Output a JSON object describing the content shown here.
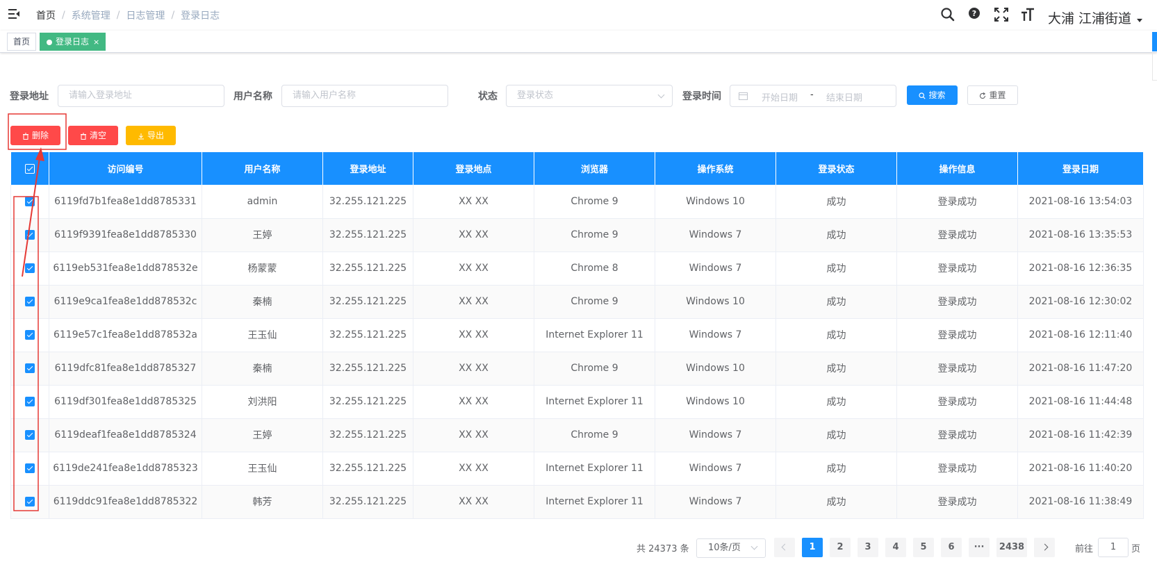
{
  "header": {
    "breadcrumb": [
      "首页",
      "系统管理",
      "日志管理",
      "登录日志"
    ],
    "user_name": "大浦  江浦街道",
    "icons": [
      "search-icon",
      "help-icon",
      "fullscreen-icon",
      "font-size-icon"
    ]
  },
  "tags": [
    {
      "label": "首页",
      "active": false
    },
    {
      "label": "登录日志",
      "active": true,
      "close": "×"
    }
  ],
  "search": {
    "ipaddr_label": "登录地址",
    "ipaddr_placeholder": "请输入登录地址",
    "username_label": "用户名称",
    "username_placeholder": "请输入用户名称",
    "status_label": "状态",
    "status_placeholder": "登录状态",
    "time_label": "登录时间",
    "start_placeholder": "开始日期",
    "range_separator": "-",
    "end_placeholder": "结束日期",
    "search_btn": "搜索",
    "reset_btn": "重置"
  },
  "toolbar": {
    "delete_btn": "删除",
    "clean_btn": "清空",
    "export_btn": "导出"
  },
  "table": {
    "columns": [
      "访问编号",
      "用户名称",
      "登录地址",
      "登录地点",
      "浏览器",
      "操作系统",
      "登录状态",
      "操作信息",
      "登录日期"
    ],
    "rows": [
      [
        "6119fd7b1fea8e1dd8785331",
        "admin",
        "32.255.121.225",
        "XX XX",
        "Chrome 9",
        "Windows 10",
        "成功",
        "登录成功",
        "2021-08-16 13:54:03"
      ],
      [
        "6119f9391fea8e1dd8785330",
        "王婷",
        "32.255.121.225",
        "XX XX",
        "Chrome 9",
        "Windows 7",
        "成功",
        "登录成功",
        "2021-08-16 13:35:53"
      ],
      [
        "6119eb531fea8e1dd878532e",
        "杨蒙蒙",
        "32.255.121.225",
        "XX XX",
        "Chrome 8",
        "Windows 7",
        "成功",
        "登录成功",
        "2021-08-16 12:36:35"
      ],
      [
        "6119e9ca1fea8e1dd878532c",
        "秦楠",
        "32.255.121.225",
        "XX XX",
        "Chrome 9",
        "Windows 10",
        "成功",
        "登录成功",
        "2021-08-16 12:30:02"
      ],
      [
        "6119e57c1fea8e1dd878532a",
        "王玉仙",
        "32.255.121.225",
        "XX XX",
        "Internet Explorer 11",
        "Windows 7",
        "成功",
        "登录成功",
        "2021-08-16 12:11:40"
      ],
      [
        "6119dfc81fea8e1dd8785327",
        "秦楠",
        "32.255.121.225",
        "XX XX",
        "Chrome 9",
        "Windows 10",
        "成功",
        "登录成功",
        "2021-08-16 11:47:20"
      ],
      [
        "6119df301fea8e1dd8785325",
        "刘洪阳",
        "32.255.121.225",
        "XX XX",
        "Internet Explorer 11",
        "Windows 10",
        "成功",
        "登录成功",
        "2021-08-16 11:44:48"
      ],
      [
        "6119deaf1fea8e1dd8785324",
        "王婷",
        "32.255.121.225",
        "XX XX",
        "Chrome 9",
        "Windows 7",
        "成功",
        "登录成功",
        "2021-08-16 11:42:39"
      ],
      [
        "6119de241fea8e1dd8785323",
        "王玉仙",
        "32.255.121.225",
        "XX XX",
        "Internet Explorer 11",
        "Windows 7",
        "成功",
        "登录成功",
        "2021-08-16 11:40:20"
      ],
      [
        "6119ddc91fea8e1dd8785322",
        "韩芳",
        "32.255.121.225",
        "XX XX",
        "Internet Explorer 11",
        "Windows 7",
        "成功",
        "登录成功",
        "2021-08-16 11:38:49"
      ]
    ]
  },
  "pagination": {
    "total": "共 24373 条",
    "page_size": "10条/页",
    "pages": [
      "1",
      "2",
      "3",
      "4",
      "5",
      "6",
      "···",
      "2438"
    ],
    "current": "1",
    "goto_prefix": "前往",
    "goto_value": "1",
    "goto_suffix": "页"
  },
  "colors": {
    "primary": "#1890ff",
    "danger": "#ff4949",
    "warning": "#ffba00",
    "tag_active": "#42b983",
    "annotation": "#e53935"
  }
}
